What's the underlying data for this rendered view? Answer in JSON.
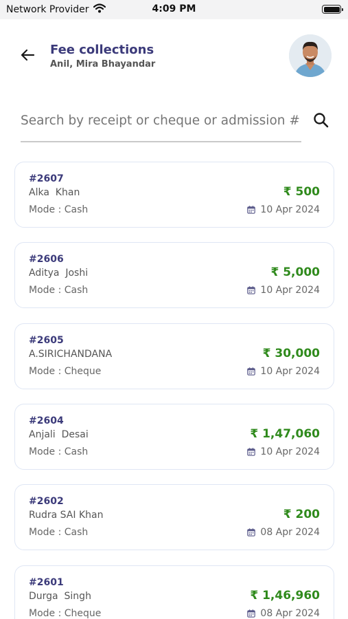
{
  "status_bar": {
    "carrier": "Network Provider",
    "time": "4:09 PM",
    "battery_level": 1.0
  },
  "header": {
    "title": "Fee collections",
    "subtitle": "Anil, Mira Bhayandar",
    "back_icon": "arrow-left-icon",
    "avatar_icon": "user-avatar"
  },
  "search": {
    "placeholder": "Search by receipt or cheque or admission #",
    "value": "",
    "icon": "search-icon"
  },
  "colors": {
    "accent": "#3b3a7a",
    "amount": "#2f8a1c",
    "card_border": "#dfe6f4"
  },
  "collections": [
    {
      "receipt": "#2607",
      "name": "Alka  Khan",
      "mode": "Mode : Cash",
      "amount": "₹ 500",
      "date": "10 Apr 2024"
    },
    {
      "receipt": "#2606",
      "name": "Aditya  Joshi",
      "mode": "Mode : Cash",
      "amount": "₹ 5,000",
      "date": "10 Apr 2024"
    },
    {
      "receipt": "#2605",
      "name": "A.SIRICHANDANA",
      "mode": "Mode : Cheque",
      "amount": "₹ 30,000",
      "date": "10 Apr 2024"
    },
    {
      "receipt": "#2604",
      "name": "Anjali  Desai",
      "mode": "Mode : Cash",
      "amount": "₹ 1,47,060",
      "date": "10 Apr 2024"
    },
    {
      "receipt": "#2602",
      "name": "Rudra SAI Khan",
      "mode": "Mode : Cash",
      "amount": "₹ 200",
      "date": "08 Apr 2024"
    },
    {
      "receipt": "#2601",
      "name": "Durga  Singh",
      "mode": "Mode : Cheque",
      "amount": "₹ 1,46,960",
      "date": "08 Apr 2024"
    }
  ]
}
